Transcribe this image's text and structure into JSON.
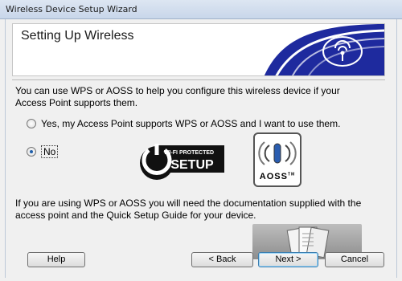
{
  "window": {
    "title": "Wireless Device Setup Wizard"
  },
  "header": {
    "title": "Setting Up Wireless"
  },
  "main": {
    "description": "You can use WPS or AOSS to help you configure this wireless device if your Access Point supports them.",
    "options": [
      {
        "label": "Yes, my Access Point supports WPS or AOSS and I want to use them.",
        "selected": false
      },
      {
        "label": "No",
        "selected": true
      }
    ],
    "wps_logo": {
      "line1": "WI-FI PROTECTED",
      "line2": "SETUP"
    },
    "aoss_logo": {
      "label": "AOSS",
      "tm": "TM"
    },
    "note": "If you are using WPS or AOSS you will need the documentation supplied with the access point and the Quick Setup Guide for your device."
  },
  "buttons": {
    "help": "Help",
    "back": "< Back",
    "next": "Next >",
    "cancel": "Cancel"
  },
  "colors": {
    "banner_blue": "#1e2a9e",
    "selected_radio": "#1f5ea8"
  }
}
